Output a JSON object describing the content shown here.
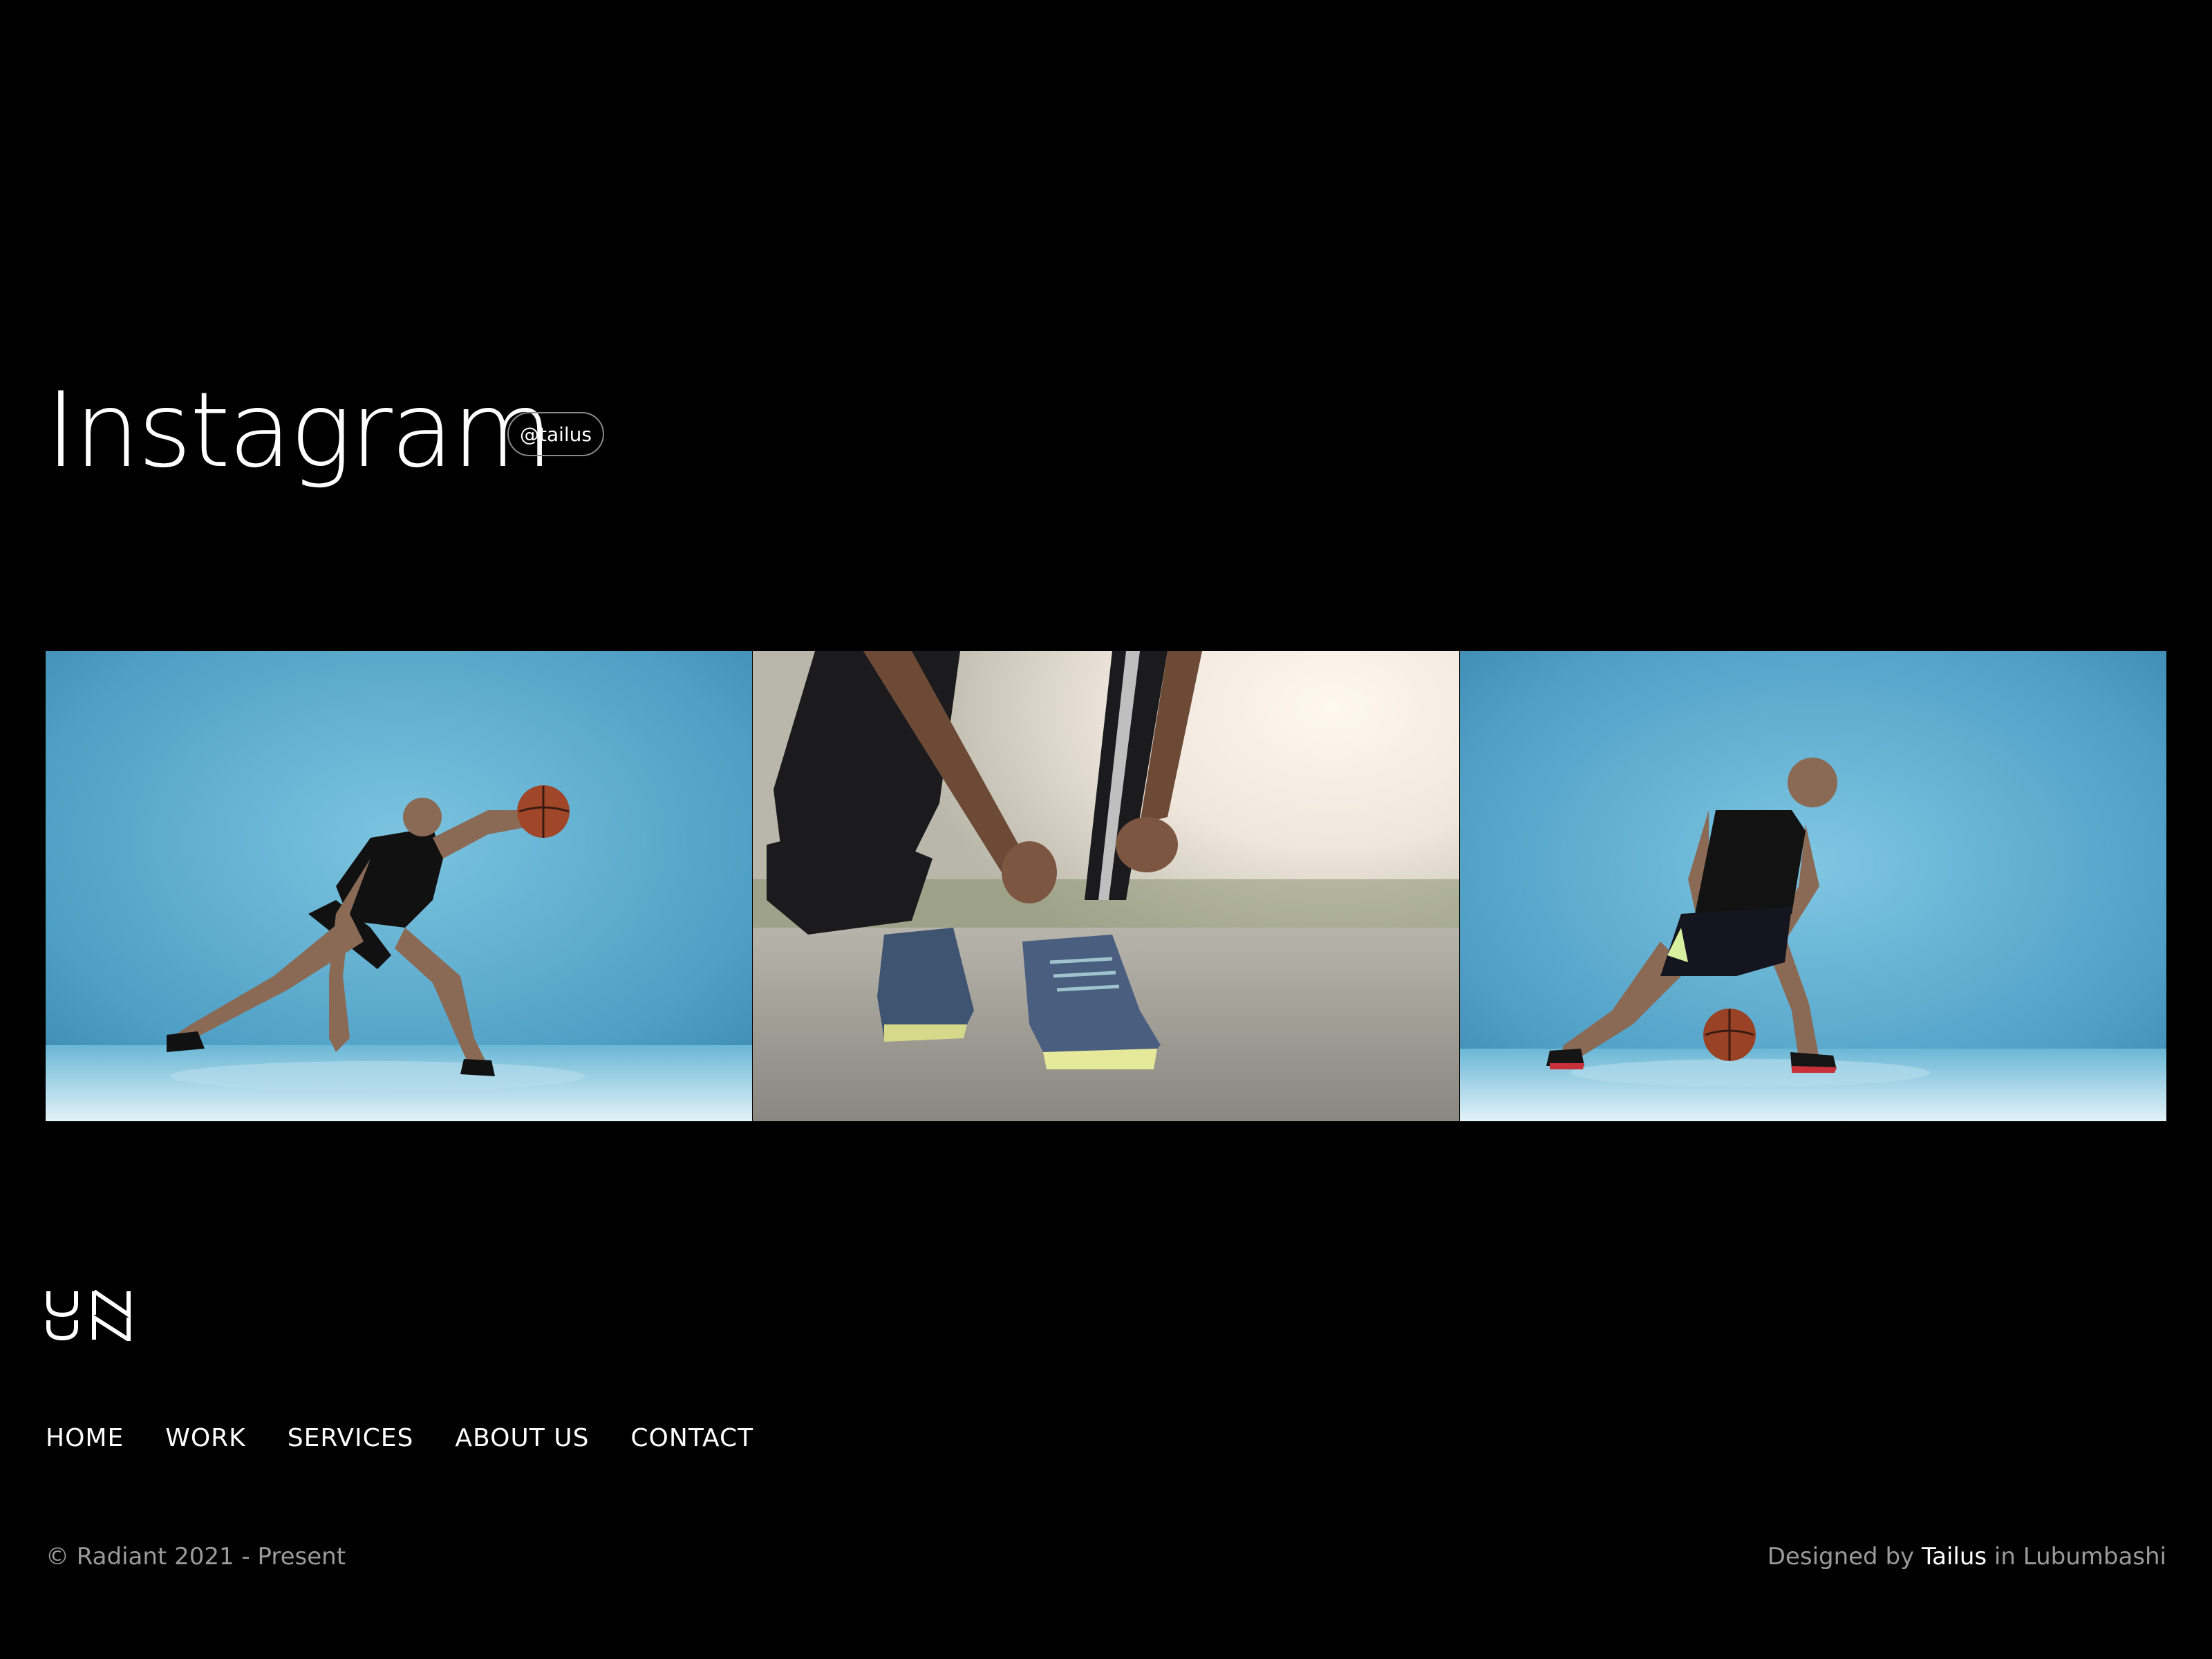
{
  "instagram": {
    "title": "Instagram",
    "handle": "@tailus"
  },
  "gallery": {
    "photos": [
      {
        "icon": "basketball-player-crouching-photo",
        "accent": "#5fb3d6"
      },
      {
        "icon": "runner-tying-shoelace-photo",
        "accent": "#c9c6bd"
      },
      {
        "icon": "basketball-player-dribbling-photo",
        "accent": "#5fb3d6"
      }
    ]
  },
  "footer": {
    "logo": "UN",
    "nav": [
      "HOME",
      "WORK",
      "SERVICES",
      "ABOUT US",
      "CONTACT"
    ],
    "copyright": "© Radiant 2021 - Present",
    "credit_prefix": "Designed by",
    "credit_name": "Tailus",
    "credit_suffix": "in Lubumbashi"
  }
}
